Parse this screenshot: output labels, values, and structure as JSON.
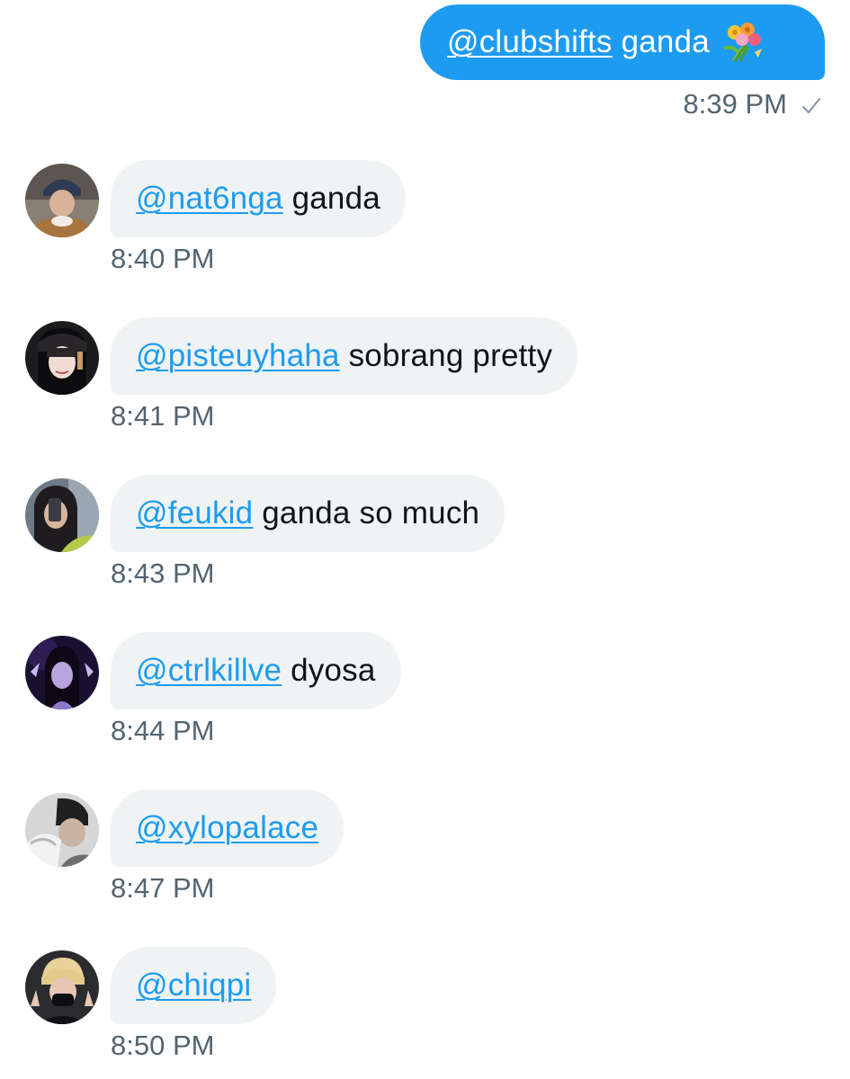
{
  "colors": {
    "accent": "#1d9bf0",
    "bubble_received": "#eff3f4",
    "text_primary": "#0f1419",
    "text_secondary": "#536471"
  },
  "sent": {
    "mention": "@clubshifts",
    "text": " ganda",
    "emoji_icon": "bouquet-icon",
    "time": "8:39 PM",
    "status_icon": "sent-check-icon"
  },
  "messages": [
    {
      "mention": "@nat6nga",
      "text": " ganda",
      "time": "8:40 PM"
    },
    {
      "mention": "@pisteuyhaha",
      "text": " sobrang pretty",
      "time": "8:41 PM"
    },
    {
      "mention": "@feukid",
      "text": " ganda so much",
      "time": "8:43 PM"
    },
    {
      "mention": "@ctrlkillve",
      "text": " dyosa",
      "time": "8:44 PM"
    },
    {
      "mention": "@xylopalace",
      "text": "",
      "time": "8:47 PM"
    },
    {
      "mention": "@chiqpi",
      "text": "",
      "time": "8:50 PM"
    }
  ]
}
